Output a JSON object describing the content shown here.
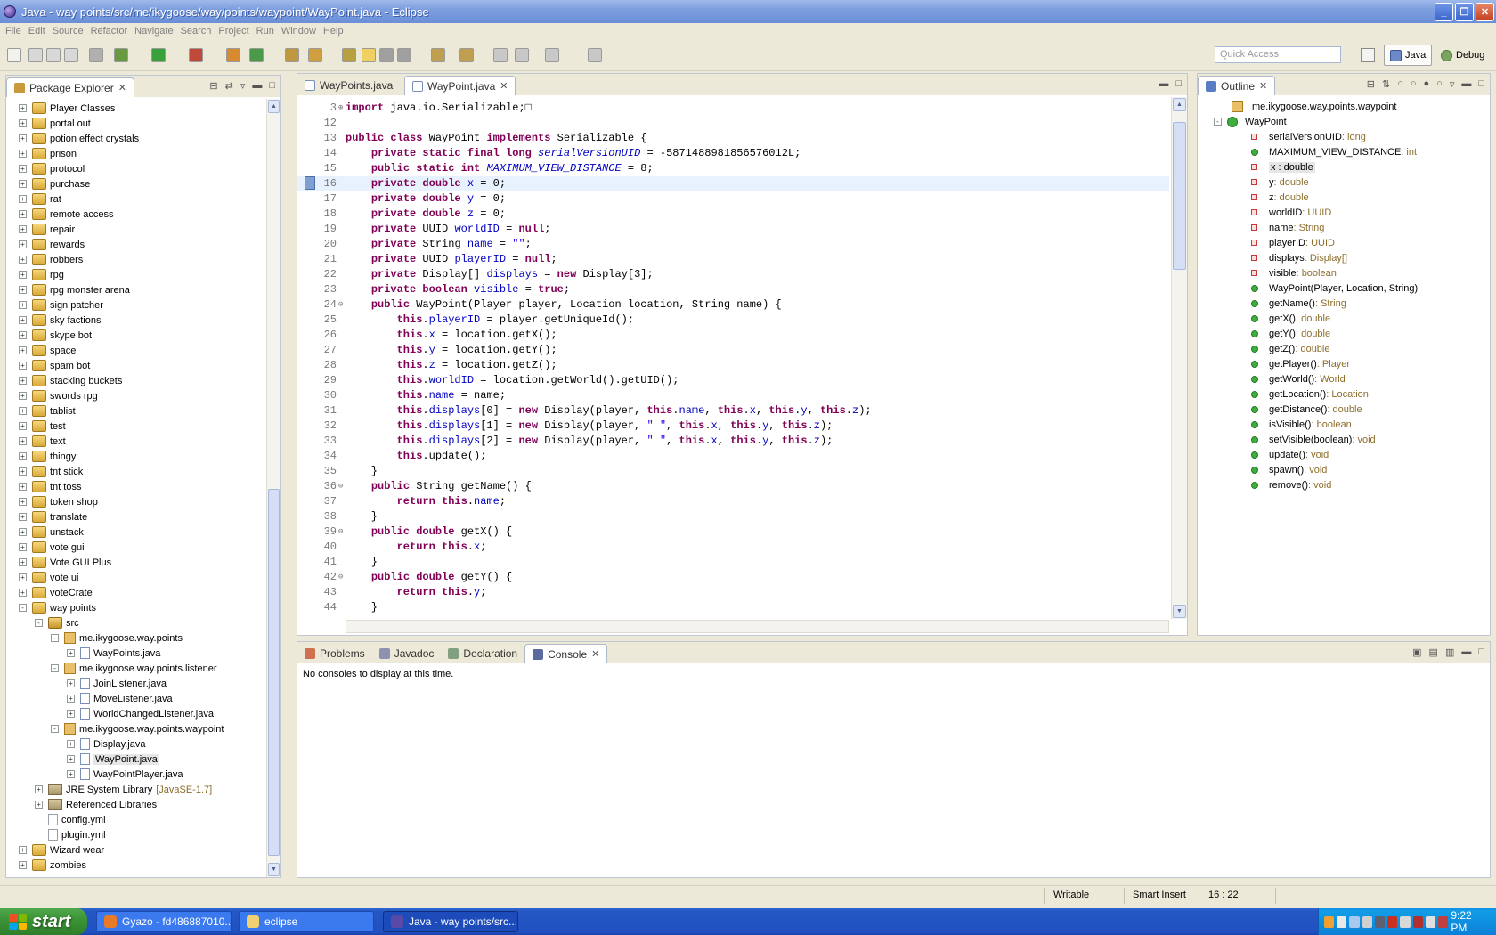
{
  "window": {
    "title": "Java - way points/src/me/ikygoose/way/points/waypoint/WayPoint.java - Eclipse"
  },
  "menu": [
    "File",
    "Edit",
    "Source",
    "Refactor",
    "Navigate",
    "Search",
    "Project",
    "Run",
    "Window",
    "Help"
  ],
  "toolbar": {
    "quick_access_placeholder": "Quick Access",
    "perspective_java": "Java",
    "perspective_debug": "Debug"
  },
  "package_explorer": {
    "title": "Package Explorer",
    "items": [
      {
        "label": "Player Classes",
        "kind": "proj",
        "depth": 0,
        "exp": "+"
      },
      {
        "label": "portal out",
        "kind": "proj",
        "depth": 0,
        "exp": "+"
      },
      {
        "label": "potion effect crystals",
        "kind": "proj",
        "depth": 0,
        "exp": "+"
      },
      {
        "label": "prison",
        "kind": "proj",
        "depth": 0,
        "exp": "+"
      },
      {
        "label": "protocol",
        "kind": "proj",
        "depth": 0,
        "exp": "+"
      },
      {
        "label": "purchase",
        "kind": "proj",
        "depth": 0,
        "exp": "+"
      },
      {
        "label": "rat",
        "kind": "proj",
        "depth": 0,
        "exp": "+"
      },
      {
        "label": "remote access",
        "kind": "proj",
        "depth": 0,
        "exp": "+"
      },
      {
        "label": "repair",
        "kind": "proj",
        "depth": 0,
        "exp": "+"
      },
      {
        "label": "rewards",
        "kind": "proj",
        "depth": 0,
        "exp": "+"
      },
      {
        "label": "robbers",
        "kind": "proj",
        "depth": 0,
        "exp": "+"
      },
      {
        "label": "rpg",
        "kind": "proj",
        "depth": 0,
        "exp": "+"
      },
      {
        "label": "rpg monster arena",
        "kind": "proj",
        "depth": 0,
        "exp": "+"
      },
      {
        "label": "sign patcher",
        "kind": "proj",
        "depth": 0,
        "exp": "+"
      },
      {
        "label": "sky factions",
        "kind": "proj",
        "depth": 0,
        "exp": "+"
      },
      {
        "label": "skype bot",
        "kind": "proj",
        "depth": 0,
        "exp": "+"
      },
      {
        "label": "space",
        "kind": "proj",
        "depth": 0,
        "exp": "+"
      },
      {
        "label": "spam bot",
        "kind": "proj",
        "depth": 0,
        "exp": "+"
      },
      {
        "label": "stacking buckets",
        "kind": "proj",
        "depth": 0,
        "exp": "+"
      },
      {
        "label": "swords rpg",
        "kind": "proj",
        "depth": 0,
        "exp": "+"
      },
      {
        "label": "tablist",
        "kind": "proj",
        "depth": 0,
        "exp": "+"
      },
      {
        "label": "test",
        "kind": "proj",
        "depth": 0,
        "exp": "+"
      },
      {
        "label": "text",
        "kind": "proj",
        "depth": 0,
        "exp": "+"
      },
      {
        "label": "thingy",
        "kind": "proj",
        "depth": 0,
        "exp": "+"
      },
      {
        "label": "tnt stick",
        "kind": "proj",
        "depth": 0,
        "exp": "+"
      },
      {
        "label": "tnt toss",
        "kind": "proj",
        "depth": 0,
        "exp": "+"
      },
      {
        "label": "token shop",
        "kind": "proj",
        "depth": 0,
        "exp": "+"
      },
      {
        "label": "translate",
        "kind": "proj",
        "depth": 0,
        "exp": "+"
      },
      {
        "label": "unstack",
        "kind": "proj",
        "depth": 0,
        "exp": "+"
      },
      {
        "label": "vote gui",
        "kind": "proj",
        "depth": 0,
        "exp": "+"
      },
      {
        "label": "Vote GUI Plus",
        "kind": "proj",
        "depth": 0,
        "exp": "+"
      },
      {
        "label": "vote ui",
        "kind": "proj",
        "depth": 0,
        "exp": "+"
      },
      {
        "label": "voteCrate",
        "kind": "proj",
        "depth": 0,
        "exp": "+"
      },
      {
        "label": "way points",
        "kind": "proj",
        "depth": 0,
        "exp": "-"
      },
      {
        "label": "src",
        "kind": "src",
        "depth": 1,
        "exp": "-"
      },
      {
        "label": "me.ikygoose.way.points",
        "kind": "pkg",
        "depth": 2,
        "exp": "-"
      },
      {
        "label": "WayPoints.java",
        "kind": "java",
        "depth": 3,
        "exp": "+"
      },
      {
        "label": "me.ikygoose.way.points.listener",
        "kind": "pkg",
        "depth": 2,
        "exp": "-"
      },
      {
        "label": "JoinListener.java",
        "kind": "java",
        "depth": 3,
        "exp": "+"
      },
      {
        "label": "MoveListener.java",
        "kind": "java",
        "depth": 3,
        "exp": "+"
      },
      {
        "label": "WorldChangedListener.java",
        "kind": "java",
        "depth": 3,
        "exp": "+"
      },
      {
        "label": "me.ikygoose.way.points.waypoint",
        "kind": "pkg",
        "depth": 2,
        "exp": "-"
      },
      {
        "label": "Display.java",
        "kind": "java",
        "depth": 3,
        "exp": "+"
      },
      {
        "label": "WayPoint.java",
        "kind": "java",
        "depth": 3,
        "exp": "+",
        "selected": true
      },
      {
        "label": "WayPointPlayer.java",
        "kind": "java",
        "depth": 3,
        "exp": "+"
      },
      {
        "label": "JRE System Library",
        "suffix": "[JavaSE-1.7]",
        "kind": "lib",
        "depth": 1,
        "exp": "+"
      },
      {
        "label": "Referenced Libraries",
        "kind": "lib",
        "depth": 1,
        "exp": "+"
      },
      {
        "label": "config.yml",
        "kind": "file",
        "depth": 1,
        "exp": ""
      },
      {
        "label": "plugin.yml",
        "kind": "file",
        "depth": 1,
        "exp": ""
      },
      {
        "label": "Wizard wear",
        "kind": "proj",
        "depth": 0,
        "exp": "+"
      },
      {
        "label": "zombies",
        "kind": "proj",
        "depth": 0,
        "exp": "+"
      }
    ]
  },
  "editor": {
    "tabs": [
      {
        "label": "WayPoints.java",
        "active": false
      },
      {
        "label": "WayPoint.java",
        "active": true
      }
    ],
    "highlight_line": 16,
    "lines": [
      {
        "n": "3",
        "fold": "+",
        "html": "<span class='kw'>import</span> java.io.Serializable;&#9633;"
      },
      {
        "n": "12",
        "fold": "",
        "html": ""
      },
      {
        "n": "13",
        "fold": "",
        "html": "<span class='kw'>public class</span> WayPoint <span class='kw'>implements</span> Serializable {"
      },
      {
        "n": "14",
        "fold": "",
        "html": "    <span class='kw'>private static final long</span> <span class='sfld'>serialVersionUID</span> = -5871488981856576012L;"
      },
      {
        "n": "15",
        "fold": "",
        "html": "    <span class='kw'>public static int</span> <span class='sfld'>MAXIMUM_VIEW_DISTANCE</span> = 8;"
      },
      {
        "n": "16",
        "fold": "",
        "html": "    <span class='kw'>private double</span> <span class='fld'>x</span> = 0;"
      },
      {
        "n": "17",
        "fold": "",
        "html": "    <span class='kw'>private double</span> <span class='fld'>y</span> = 0;"
      },
      {
        "n": "18",
        "fold": "",
        "html": "    <span class='kw'>private double</span> <span class='fld'>z</span> = 0;"
      },
      {
        "n": "19",
        "fold": "",
        "html": "    <span class='kw'>private</span> UUID <span class='fld'>worldID</span> = <span class='kw'>null</span>;"
      },
      {
        "n": "20",
        "fold": "",
        "html": "    <span class='kw'>private</span> String <span class='fld'>name</span> = <span class='str'>\"\"</span>;"
      },
      {
        "n": "21",
        "fold": "",
        "html": "    <span class='kw'>private</span> UUID <span class='fld'>playerID</span> = <span class='kw'>null</span>;"
      },
      {
        "n": "22",
        "fold": "",
        "html": "    <span class='kw'>private</span> Display[] <span class='fld'>displays</span> = <span class='kw'>new</span> Display[3];"
      },
      {
        "n": "23",
        "fold": "",
        "html": "    <span class='kw'>private boolean</span> <span class='fld'>visible</span> = <span class='kw'>true</span>;"
      },
      {
        "n": "24",
        "fold": "-",
        "html": "    <span class='kw'>public</span> WayPoint(Player player, Location location, String name) {"
      },
      {
        "n": "25",
        "fold": "",
        "html": "        <span class='kw'>this</span>.<span class='fld'>playerID</span> = player.getUniqueId();"
      },
      {
        "n": "26",
        "fold": "",
        "html": "        <span class='kw'>this</span>.<span class='fld'>x</span> = location.getX();"
      },
      {
        "n": "27",
        "fold": "",
        "html": "        <span class='kw'>this</span>.<span class='fld'>y</span> = location.getY();"
      },
      {
        "n": "28",
        "fold": "",
        "html": "        <span class='kw'>this</span>.<span class='fld'>z</span> = location.getZ();"
      },
      {
        "n": "29",
        "fold": "",
        "html": "        <span class='kw'>this</span>.<span class='fld'>worldID</span> = location.getWorld().getUID();"
      },
      {
        "n": "30",
        "fold": "",
        "html": "        <span class='kw'>this</span>.<span class='fld'>name</span> = name;"
      },
      {
        "n": "31",
        "fold": "",
        "html": "        <span class='kw'>this</span>.<span class='fld'>displays</span>[0] = <span class='kw'>new</span> Display(player, <span class='kw'>this</span>.<span class='fld'>name</span>, <span class='kw'>this</span>.<span class='fld'>x</span>, <span class='kw'>this</span>.<span class='fld'>y</span>, <span class='kw'>this</span>.<span class='fld'>z</span>);"
      },
      {
        "n": "32",
        "fold": "",
        "html": "        <span class='kw'>this</span>.<span class='fld'>displays</span>[1] = <span class='kw'>new</span> Display(player, <span class='str'>\" \"</span>, <span class='kw'>this</span>.<span class='fld'>x</span>, <span class='kw'>this</span>.<span class='fld'>y</span>, <span class='kw'>this</span>.<span class='fld'>z</span>);"
      },
      {
        "n": "33",
        "fold": "",
        "html": "        <span class='kw'>this</span>.<span class='fld'>displays</span>[2] = <span class='kw'>new</span> Display(player, <span class='str'>\" \"</span>, <span class='kw'>this</span>.<span class='fld'>x</span>, <span class='kw'>this</span>.<span class='fld'>y</span>, <span class='kw'>this</span>.<span class='fld'>z</span>);"
      },
      {
        "n": "34",
        "fold": "",
        "html": "        <span class='kw'>this</span>.update();"
      },
      {
        "n": "35",
        "fold": "",
        "html": "    }"
      },
      {
        "n": "36",
        "fold": "-",
        "html": "    <span class='kw'>public</span> String getName() {"
      },
      {
        "n": "37",
        "fold": "",
        "html": "        <span class='kw'>return this</span>.<span class='fld'>name</span>;"
      },
      {
        "n": "38",
        "fold": "",
        "html": "    }"
      },
      {
        "n": "39",
        "fold": "-",
        "html": "    <span class='kw'>public double</span> getX() {"
      },
      {
        "n": "40",
        "fold": "",
        "html": "        <span class='kw'>return this</span>.<span class='fld'>x</span>;"
      },
      {
        "n": "41",
        "fold": "",
        "html": "    }"
      },
      {
        "n": "42",
        "fold": "-",
        "html": "    <span class='kw'>public double</span> getY() {"
      },
      {
        "n": "43",
        "fold": "",
        "html": "        <span class='kw'>return this</span>.<span class='fld'>y</span>;"
      },
      {
        "n": "44",
        "fold": "",
        "html": "    }"
      }
    ]
  },
  "outline": {
    "title": "Outline",
    "package": "me.ikygoose.way.points.waypoint",
    "class_name": "WayPoint",
    "members": [
      {
        "name": "serialVersionUID",
        "type": " : long",
        "kind": "sf"
      },
      {
        "name": "MAXIMUM_VIEW_DISTANCE",
        "type": " : int",
        "kind": "s"
      },
      {
        "name": "x : double",
        "type": "",
        "kind": "p",
        "selected": true
      },
      {
        "name": "y",
        "type": " : double",
        "kind": "p"
      },
      {
        "name": "z",
        "type": " : double",
        "kind": "p"
      },
      {
        "name": "worldID",
        "type": " : UUID",
        "kind": "p"
      },
      {
        "name": "name",
        "type": " : String",
        "kind": "p"
      },
      {
        "name": "playerID",
        "type": " : UUID",
        "kind": "p"
      },
      {
        "name": "displays",
        "type": " : Display[]",
        "kind": "p"
      },
      {
        "name": "visible",
        "type": " : boolean",
        "kind": "p"
      },
      {
        "name": "WayPoint(Player, Location, String)",
        "type": "",
        "kind": "c"
      },
      {
        "name": "getName()",
        "type": " : String",
        "kind": "m"
      },
      {
        "name": "getX()",
        "type": " : double",
        "kind": "m"
      },
      {
        "name": "getY()",
        "type": " : double",
        "kind": "m"
      },
      {
        "name": "getZ()",
        "type": " : double",
        "kind": "m"
      },
      {
        "name": "getPlayer()",
        "type": " : Player",
        "kind": "m"
      },
      {
        "name": "getWorld()",
        "type": " : World",
        "kind": "m"
      },
      {
        "name": "getLocation()",
        "type": " : Location",
        "kind": "m"
      },
      {
        "name": "getDistance()",
        "type": " : double",
        "kind": "m"
      },
      {
        "name": "isVisible()",
        "type": " : boolean",
        "kind": "m"
      },
      {
        "name": "setVisible(boolean)",
        "type": " : void",
        "kind": "m"
      },
      {
        "name": "update()",
        "type": " : void",
        "kind": "m"
      },
      {
        "name": "spawn()",
        "type": " : void",
        "kind": "m"
      },
      {
        "name": "remove()",
        "type": " : void",
        "kind": "m"
      }
    ]
  },
  "bottom_panel": {
    "tabs": [
      {
        "label": "Problems",
        "active": false
      },
      {
        "label": "Javadoc",
        "active": false
      },
      {
        "label": "Declaration",
        "active": false
      },
      {
        "label": "Console",
        "active": true
      }
    ],
    "message": "No consoles to display at this time."
  },
  "status": {
    "writable": "Writable",
    "insert_mode": "Smart Insert",
    "position": "16 : 22"
  },
  "taskbar": {
    "start_label": "start",
    "tasks": [
      {
        "label": "Gyazo - fd486887010...",
        "active": false
      },
      {
        "label": "eclipse",
        "active": false
      },
      {
        "label": "Java - way points/src...",
        "active": true
      }
    ],
    "clock": "9:22 PM"
  }
}
